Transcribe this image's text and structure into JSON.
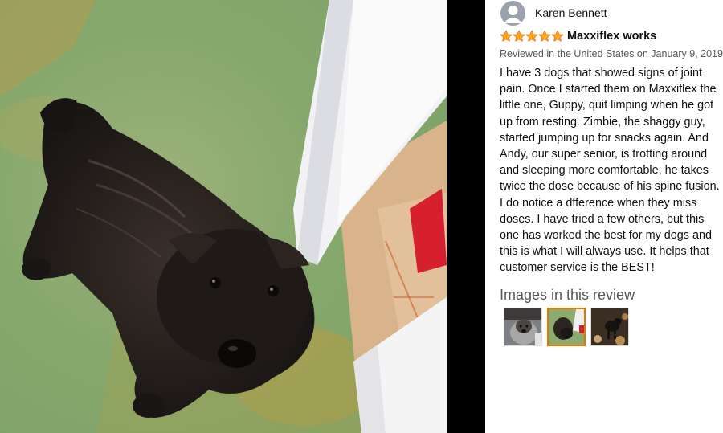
{
  "review": {
    "reviewer_name": "Karen Bennett",
    "rating": 5,
    "title": "Maxxiflex works",
    "meta": "Reviewed in the United States on January 9, 2019",
    "body": "I have 3 dogs that showed signs of joint pain. Once I started them on Maxxiflex the little one, Guppy, quit limping when he got up from resting. Zimbie, the shaggy guy, started jumping up for snacks again. And Andy, our super senior, is trotting around and sleeping more comfortable, he takes twice the dose because of his spine fusion. I do notice a dfference when they miss doses. I have tried a few others, but this one has worked the best for my dogs and this is what I will always use. It helps that customer service is the BEST!"
  },
  "images_section": {
    "header": "Images in this review",
    "selected_index": 1
  },
  "colors": {
    "star": "#ffa41c",
    "star_outline": "#de7921",
    "selected_border": "#e77600",
    "meta_text": "#565959"
  }
}
